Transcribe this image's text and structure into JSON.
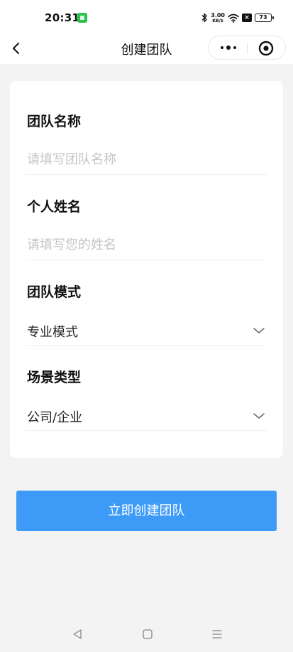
{
  "status_bar": {
    "time": "20:31",
    "net_speed": "3.00",
    "net_unit": "KB/S",
    "battery": "73"
  },
  "nav": {
    "title": "创建团队",
    "more_icon": "more-dots-icon",
    "close_icon": "target-close-icon"
  },
  "form": {
    "team_name": {
      "label": "团队名称",
      "placeholder": "请填写团队名称",
      "value": ""
    },
    "person_name": {
      "label": "个人姓名",
      "placeholder": "请填写您的姓名",
      "value": ""
    },
    "team_mode": {
      "label": "团队模式",
      "selected": "专业模式"
    },
    "scene_type": {
      "label": "场景类型",
      "selected": "公司/企业"
    }
  },
  "submit_button": {
    "label": "立即创建团队",
    "color": "#3d9bf7"
  }
}
